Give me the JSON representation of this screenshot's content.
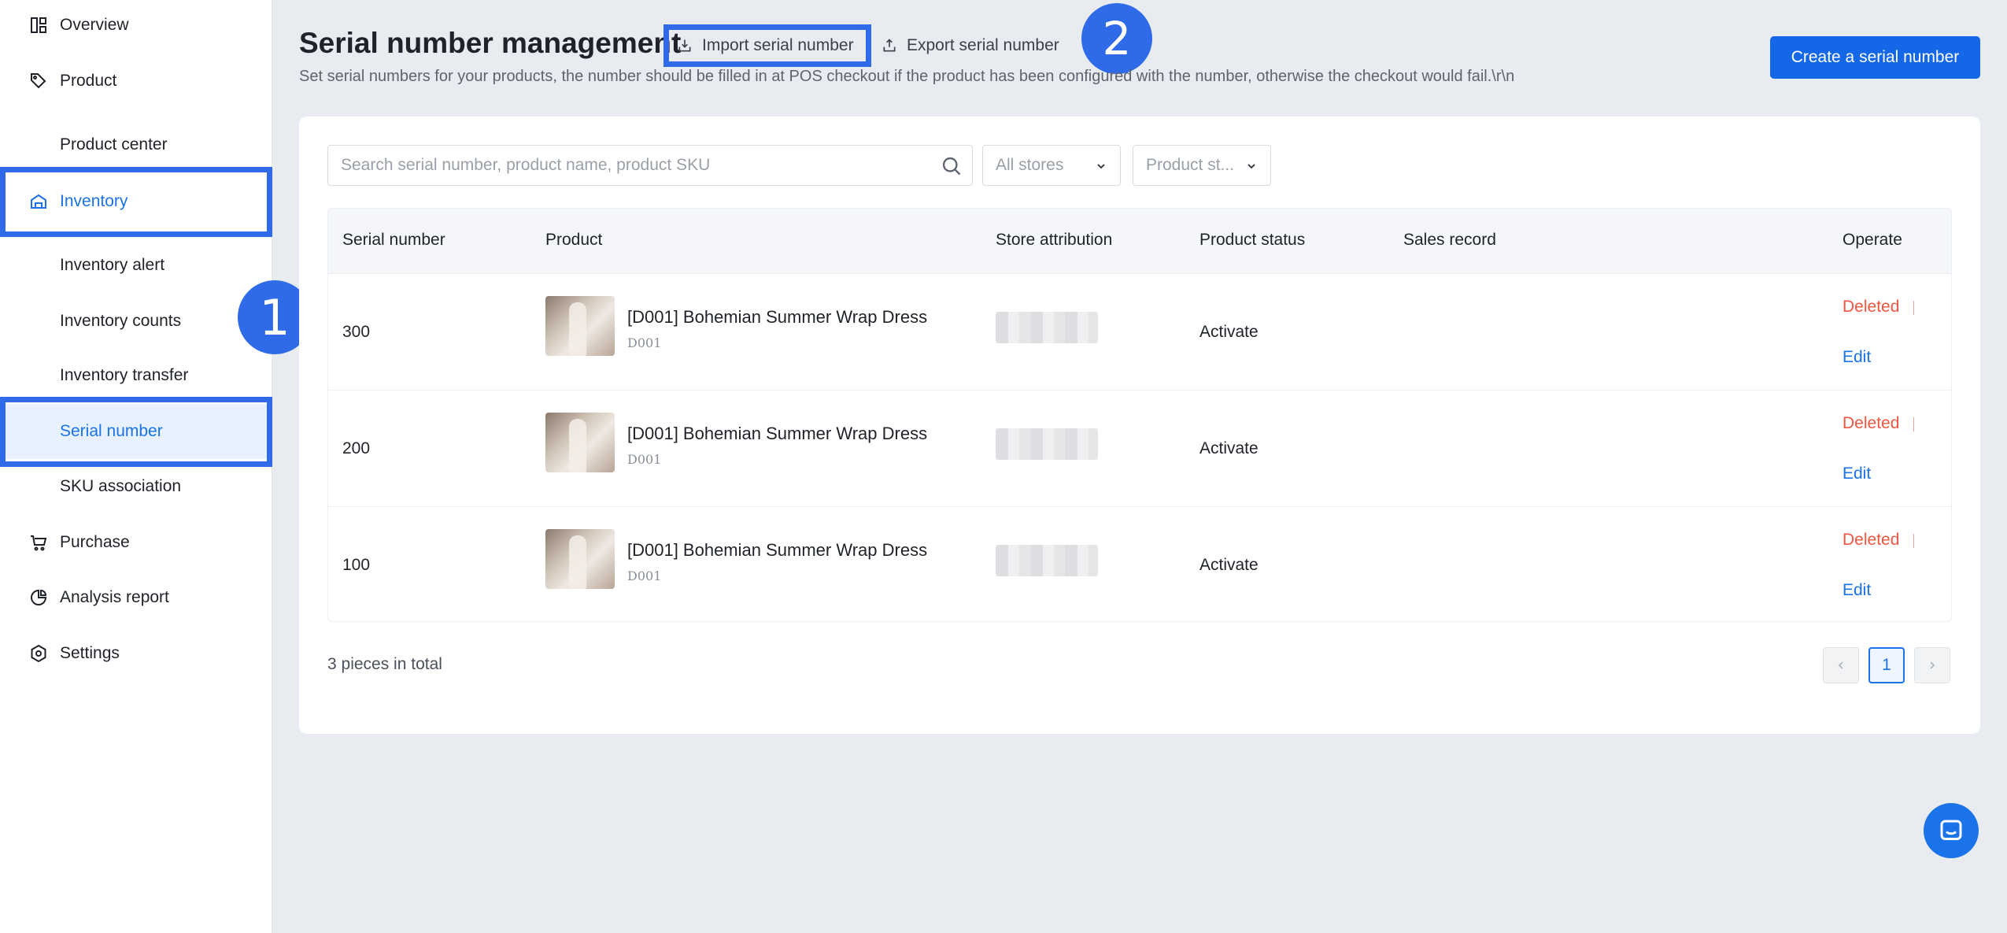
{
  "sidebar": {
    "items": [
      {
        "label": "Overview",
        "icon": "dashboard-icon"
      },
      {
        "label": "Product",
        "icon": "tag-icon"
      },
      {
        "label": "Product center"
      },
      {
        "label": "Inventory",
        "icon": "warehouse-icon"
      },
      {
        "label": "Inventory alert"
      },
      {
        "label": "Inventory counts"
      },
      {
        "label": "Inventory transfer"
      },
      {
        "label": "Serial number"
      },
      {
        "label": "SKU association"
      },
      {
        "label": "Purchase",
        "icon": "cart-icon"
      },
      {
        "label": "Analysis report",
        "icon": "pie-chart-icon"
      },
      {
        "label": "Settings",
        "icon": "gear-icon"
      }
    ],
    "active_color": "#1a73e8"
  },
  "badges": {
    "one": "1",
    "two": "2"
  },
  "header": {
    "title": "Serial number management",
    "import_label": "Import serial number",
    "export_label": "Export serial number",
    "subtitle": "Set serial numbers for your products, the number should be filled in at POS checkout if the product has been configured with the number, otherwise the checkout would fail.\\r\\n",
    "create_label": "Create a serial number"
  },
  "filters": {
    "search_placeholder": "Search serial number, product name, product SKU",
    "store_select": "All stores",
    "status_select": "Product st..."
  },
  "table": {
    "columns": {
      "serial": "Serial number",
      "product": "Product",
      "store": "Store attribution",
      "status": "Product status",
      "sales": "Sales record",
      "operate": "Operate"
    },
    "rows": [
      {
        "serial": "300",
        "product_name": "[D001] Bohemian Summer Wrap Dress",
        "sku": "D001",
        "status": "Activate",
        "delete_label": "Deleted",
        "edit_label": "Edit"
      },
      {
        "serial": "200",
        "product_name": "[D001] Bohemian Summer Wrap Dress",
        "sku": "D001",
        "status": "Activate",
        "delete_label": "Deleted",
        "edit_label": "Edit"
      },
      {
        "serial": "100",
        "product_name": "[D001] Bohemian Summer Wrap Dress",
        "sku": "D001",
        "status": "Activate",
        "delete_label": "Deleted",
        "edit_label": "Edit"
      }
    ]
  },
  "footer": {
    "total": "3 pieces in total",
    "current_page": "1"
  },
  "colors": {
    "primary": "#1467e6",
    "highlight": "#2f6be8",
    "danger": "#f05540"
  }
}
